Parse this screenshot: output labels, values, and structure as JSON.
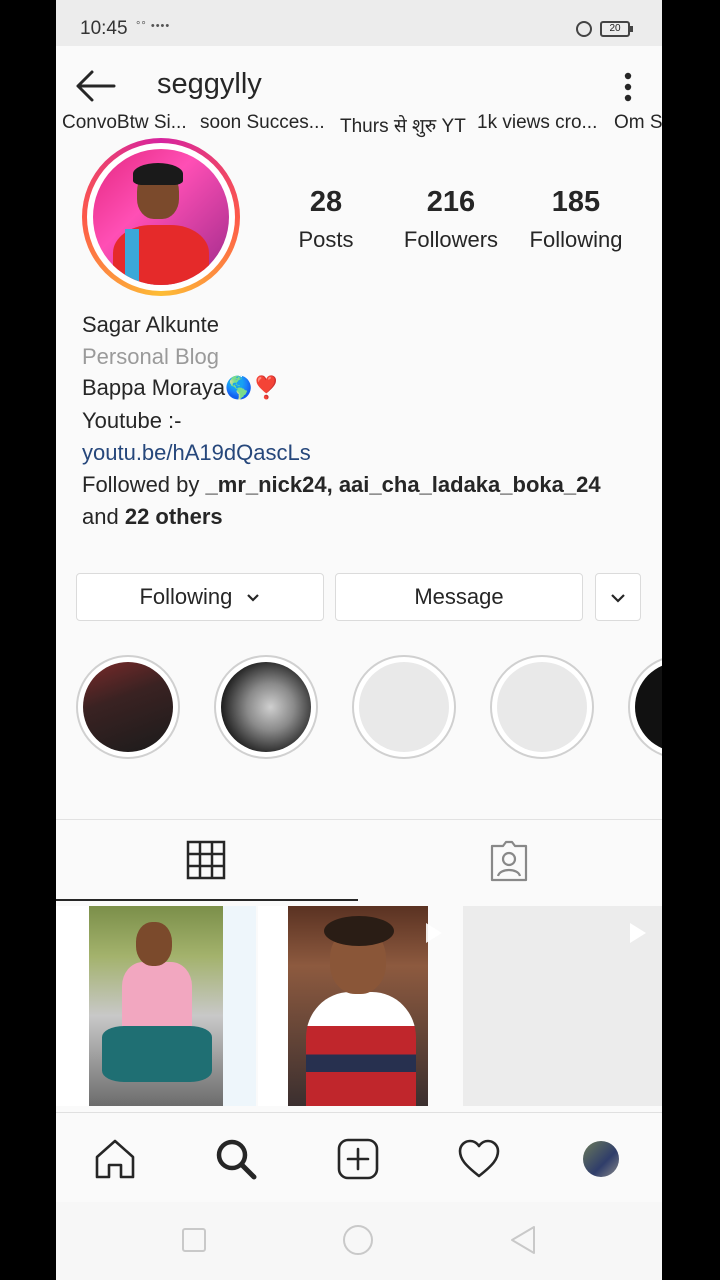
{
  "status": {
    "time": "10:45",
    "signal": "°° ••••",
    "battery": "20"
  },
  "header": {
    "username": "seggylly"
  },
  "stats": [
    {
      "num": "28",
      "label": "Posts"
    },
    {
      "num": "216",
      "label": "Followers"
    },
    {
      "num": "185",
      "label": "Following"
    }
  ],
  "bio": {
    "name": "Sagar Alkunte",
    "category": "Personal Blog",
    "line1": "Bappa Moraya🌎❣️",
    "line2": "Youtube :-",
    "link": "youtu.be/hA19dQascLs",
    "followed_by_prefix": "Followed by ",
    "followed_by_users": "_mr_nick24, aai_cha_ladaka_boka_24",
    "followed_by_and": "and ",
    "followed_by_others": "22 others"
  },
  "buttons": {
    "following": "Following",
    "message": "Message"
  },
  "highlights": [
    {
      "label": "ConvoBtw Si..."
    },
    {
      "label": "soon Succes..."
    },
    {
      "label": "Thurs से शुरु YT"
    },
    {
      "label": "1k views cro..."
    },
    {
      "label": "Om S"
    }
  ],
  "icons": {
    "back": "arrow-left-icon",
    "more": "vertical-dots-icon",
    "dropdown": "chevron-down-icon",
    "grid": "grid-icon",
    "tagged": "tagged-person-icon",
    "play": "play-icon",
    "home": "home-icon",
    "search": "search-icon",
    "add": "add-post-icon",
    "heart": "heart-icon"
  },
  "colors": {
    "link": "#26477b",
    "category": "#9a9a9a"
  }
}
